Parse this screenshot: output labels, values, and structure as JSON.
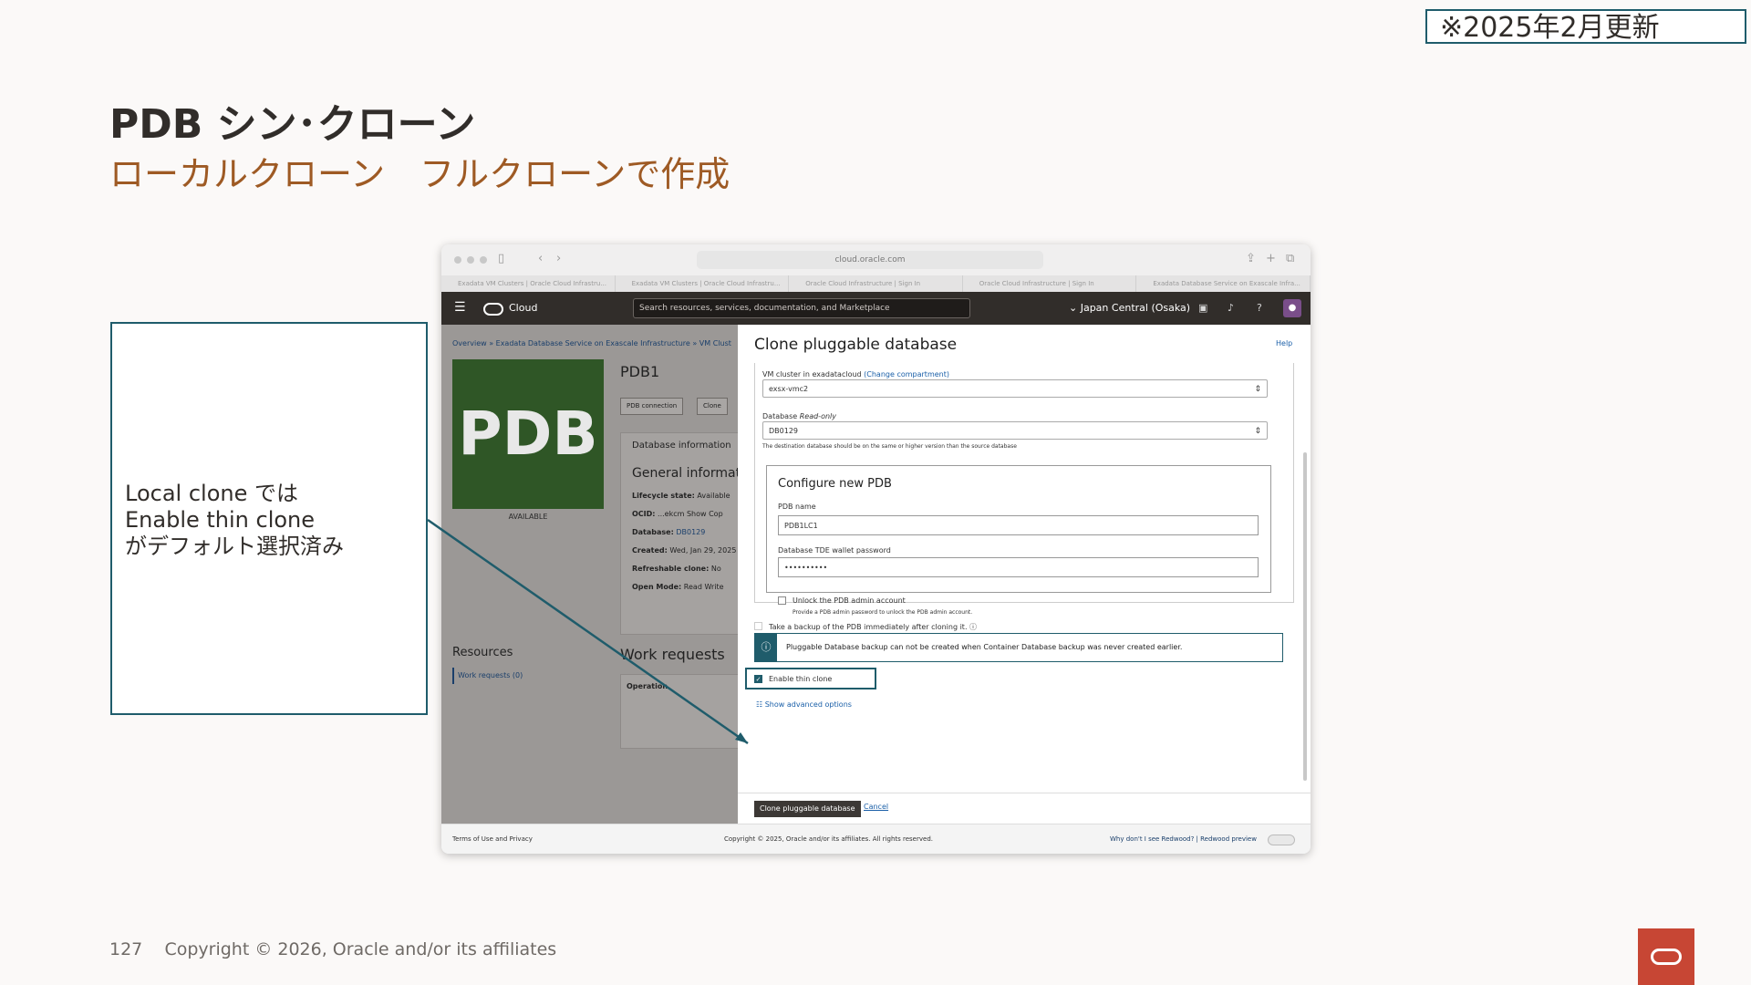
{
  "slide": {
    "update_note": "※2025年2月更新",
    "title": "PDB シン･クローン",
    "subtitle": "ローカルクローン　フルクローンで作成",
    "callout_lines": [
      "Local clone では",
      "Enable thin clone",
      "がデフォルト選択済み"
    ],
    "page_number": "127",
    "copyright": "Copyright © 2026, Oracle and/or its affiliates"
  },
  "browser": {
    "url": "cloud.oracle.com",
    "tabs": [
      "Exadata VM Clusters | Oracle Cloud Infrastru...",
      "Exadata VM Clusters | Oracle Cloud Infrastru...",
      "Oracle Cloud Infrastructure | Sign In",
      "Oracle Cloud Infrastructure | Sign In",
      "Exadata Database Service on Exascale Infra..."
    ]
  },
  "oci": {
    "brand": "Cloud",
    "search_placeholder": "Search resources, services, documentation, and Marketplace",
    "region": "Japan Central (Osaka)"
  },
  "page": {
    "breadcrumb": "Overview » Exadata Database Service on Exascale Infrastructure » VM Clust",
    "tile_text": "PDB",
    "status": "AVAILABLE",
    "name": "PDB1",
    "buttons": [
      "PDB connection",
      "Clone"
    ],
    "info_title": "Database information",
    "info_heading": "General informat",
    "info_rows": [
      {
        "label": "Lifecycle state:",
        "value": "Available"
      },
      {
        "label": "OCID:",
        "value": "...ekcm Show Cop"
      },
      {
        "label": "Database:",
        "value": "DB0129"
      },
      {
        "label": "Created:",
        "value": "Wed, Jan 29, 2025"
      },
      {
        "label": "Refreshable clone:",
        "value": "No"
      },
      {
        "label": "Open Mode:",
        "value": "Read Write"
      }
    ],
    "resources_title": "Resources",
    "resources_link": "Work requests (0)",
    "work_requests_title": "Work requests",
    "work_requests_col": "Operation"
  },
  "drawer": {
    "title": "Clone pluggable database",
    "help": "Help",
    "vm_cluster_label": "VM cluster in exadatacloud",
    "vm_cluster_change": "(Change compartment)",
    "vm_cluster_value": "exsx-vmc2",
    "database_label": "Database",
    "database_readonly": "Read-only",
    "database_value": "DB0129",
    "database_hint": "The destination database should be on the same or higher version than the source database",
    "configure_title": "Configure new PDB",
    "pdb_name_label": "PDB name",
    "pdb_name_value": "PDB1LC1",
    "wallet_label": "Database TDE wallet password",
    "wallet_value": "••••••••••",
    "unlock_label": "Unlock the PDB admin account",
    "unlock_hint": "Provide a PDB admin password to unlock the PDB admin account.",
    "backup_label": "Take a backup of the PDB immediately after cloning it.",
    "notice": "Pluggable Database backup can not be created when Container Database backup was never created earlier.",
    "thin_clone_label": "Enable thin clone",
    "advanced": "Show advanced options",
    "submit": "Clone pluggable database",
    "cancel": "Cancel"
  },
  "status_bar": {
    "terms": "Terms of Use and Privacy",
    "copyright": "Copyright © 2025, Oracle and/or its affiliates. All rights reserved.",
    "redwood": "Why don't I see Redwood? | Redwood preview"
  },
  "colors": {
    "accent": "#1f5c6b",
    "subtitle": "#9e5a24",
    "oracle_red": "#c74634",
    "pdb_tile": "#2f5626"
  }
}
